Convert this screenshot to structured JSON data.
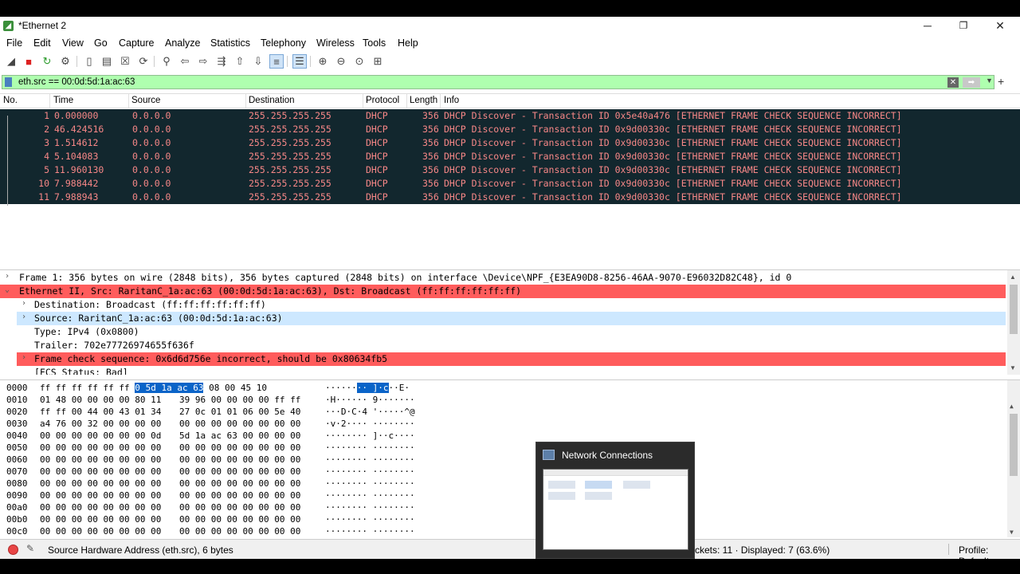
{
  "window": {
    "title": "*Ethernet 2",
    "app_icon_glyph": "◢"
  },
  "window_controls": {
    "minimize": "─",
    "restore": "❐",
    "close": "✕"
  },
  "menu": [
    "File",
    "Edit",
    "View",
    "Go",
    "Capture",
    "Analyze",
    "Statistics",
    "Telephony",
    "Wireless",
    "Tools",
    "Help"
  ],
  "toolbar": {
    "icons": [
      "shark-start-icon",
      "stop-capture-icon",
      "restart-capture-icon",
      "capture-options-icon",
      "open-file-icon",
      "save-file-icon",
      "close-file-icon",
      "reload-file-icon",
      "find-packet-icon",
      "go-back-icon",
      "go-forward-icon",
      "go-to-packet-icon",
      "go-first-icon",
      "go-last-icon",
      "auto-scroll-icon",
      "colorize-icon",
      "zoom-in-icon",
      "zoom-out-icon",
      "normal-size-icon",
      "resize-columns-icon"
    ],
    "glyphs": [
      "◢",
      "■",
      "↻",
      "⚙",
      "▯",
      "▤",
      "☒",
      "⟳",
      "⚲",
      "⇦",
      "⇨",
      "⇶",
      "⇧",
      "⇩",
      "≡",
      "☰",
      "⊕",
      "⊖",
      "⊙",
      "⊞"
    ]
  },
  "filter": {
    "value": "eth.src == 00:0d:5d:1a:ac:63",
    "clear_glyph": "✕",
    "apply_glyph": "➡",
    "dropdown_glyph": "▼",
    "add_glyph": "+"
  },
  "packet_list": {
    "columns": [
      "No.",
      "Time",
      "Source",
      "Destination",
      "Protocol",
      "Length",
      "Info"
    ],
    "rows": [
      {
        "no": "1",
        "time": "0.000000",
        "source": "0.0.0.0",
        "destination": "255.255.255.255",
        "protocol": "DHCP",
        "length": "356",
        "info": "DHCP Discover - Transaction ID 0x5e40a476 [ETHERNET FRAME CHECK SEQUENCE INCORRECT]"
      },
      {
        "no": "2",
        "time": "46.424516",
        "source": "0.0.0.0",
        "destination": "255.255.255.255",
        "protocol": "DHCP",
        "length": "356",
        "info": "DHCP Discover - Transaction ID 0x9d00330c [ETHERNET FRAME CHECK SEQUENCE INCORRECT]"
      },
      {
        "no": "3",
        "time": "1.514612",
        "source": "0.0.0.0",
        "destination": "255.255.255.255",
        "protocol": "DHCP",
        "length": "356",
        "info": "DHCP Discover - Transaction ID 0x9d00330c [ETHERNET FRAME CHECK SEQUENCE INCORRECT]"
      },
      {
        "no": "4",
        "time": "5.104083",
        "source": "0.0.0.0",
        "destination": "255.255.255.255",
        "protocol": "DHCP",
        "length": "356",
        "info": "DHCP Discover - Transaction ID 0x9d00330c [ETHERNET FRAME CHECK SEQUENCE INCORRECT]"
      },
      {
        "no": "5",
        "time": "11.960130",
        "source": "0.0.0.0",
        "destination": "255.255.255.255",
        "protocol": "DHCP",
        "length": "356",
        "info": "DHCP Discover - Transaction ID 0x9d00330c [ETHERNET FRAME CHECK SEQUENCE INCORRECT]"
      },
      {
        "no": "10",
        "time": "7.988442",
        "source": "0.0.0.0",
        "destination": "255.255.255.255",
        "protocol": "DHCP",
        "length": "356",
        "info": "DHCP Discover - Transaction ID 0x9d00330c [ETHERNET FRAME CHECK SEQUENCE INCORRECT]"
      },
      {
        "no": "11",
        "time": "7.988943",
        "source": "0.0.0.0",
        "destination": "255.255.255.255",
        "protocol": "DHCP",
        "length": "356",
        "info": "DHCP Discover - Transaction ID 0x9d00330c [ETHERNET FRAME CHECK SEQUENCE INCORRECT]"
      }
    ]
  },
  "details": {
    "rows": [
      {
        "text": "Frame 1: 356 bytes on wire (2848 bits), 356 bytes captured (2848 bits) on interface \\Device\\NPF_{E3EA90D8-8256-46AA-9070-E96032D82C48}, id 0",
        "arrow": "›",
        "style": "normal",
        "indent": 0
      },
      {
        "text": "Ethernet II, Src: RaritanC_1a:ac:63 (00:0d:5d:1a:ac:63), Dst: Broadcast (ff:ff:ff:ff:ff:ff)",
        "arrow": "⌄",
        "style": "red",
        "indent": 0
      },
      {
        "text": "Destination: Broadcast (ff:ff:ff:ff:ff:ff)",
        "arrow": "›",
        "style": "normal",
        "indent": 1
      },
      {
        "text": "Source: RaritanC_1a:ac:63 (00:0d:5d:1a:ac:63)",
        "arrow": "›",
        "style": "sel",
        "indent": 1
      },
      {
        "text": "Type: IPv4 (0x0800)",
        "arrow": "",
        "style": "normal",
        "indent": 1
      },
      {
        "text": "Trailer: 702e77726974655f636f",
        "arrow": "",
        "style": "normal",
        "indent": 1
      },
      {
        "text": "Frame check sequence: 0x6d6d756e incorrect, should be 0x80634fb5",
        "arrow": "›",
        "style": "red",
        "indent": 1
      },
      {
        "text": "[FCS Status: Bad]",
        "arrow": "",
        "style": "normal",
        "indent": 1
      }
    ]
  },
  "bytes": {
    "rows": [
      {
        "offset": "0000",
        "a": "ff ff ff ff ff ff ",
        "a_hl": "00 0d",
        "b_hl": "5d 1a ac 63",
        "b": " 08 00 45 10",
        "asc1": "······",
        "asc_hl": "·· ]",
        "asc_hl2": "·c",
        "asc2": "··E·"
      },
      {
        "offset": "0010",
        "a": "01 48 00 00 00 00 80 11",
        "b": "39 96 00 00 00 00 ff ff",
        "asc1": "·H······",
        "asc2": " 9·······"
      },
      {
        "offset": "0020",
        "a": "ff ff 00 44 00 43 01 34",
        "b": "27 0c 01 01 06 00 5e 40",
        "asc1": "···D·C·4",
        "asc2": " '·····^@"
      },
      {
        "offset": "0030",
        "a": "a4 76 00 32 00 00 00 00",
        "b": "00 00 00 00 00 00 00 00",
        "asc1": "·v·2····",
        "asc2": " ········"
      },
      {
        "offset": "0040",
        "a": "00 00 00 00 00 00 00 0d",
        "b": "5d 1a ac 63 00 00 00 00",
        "asc1": "········",
        "asc2": " ]··c····"
      },
      {
        "offset": "0050",
        "a": "00 00 00 00 00 00 00 00",
        "b": "00 00 00 00 00 00 00 00",
        "asc1": "········",
        "asc2": " ········"
      },
      {
        "offset": "0060",
        "a": "00 00 00 00 00 00 00 00",
        "b": "00 00 00 00 00 00 00 00",
        "asc1": "········",
        "asc2": " ········"
      },
      {
        "offset": "0070",
        "a": "00 00 00 00 00 00 00 00",
        "b": "00 00 00 00 00 00 00 00",
        "asc1": "········",
        "asc2": " ········"
      },
      {
        "offset": "0080",
        "a": "00 00 00 00 00 00 00 00",
        "b": "00 00 00 00 00 00 00 00",
        "asc1": "········",
        "asc2": " ········"
      },
      {
        "offset": "0090",
        "a": "00 00 00 00 00 00 00 00",
        "b": "00 00 00 00 00 00 00 00",
        "asc1": "········",
        "asc2": " ········"
      },
      {
        "offset": "00a0",
        "a": "00 00 00 00 00 00 00 00",
        "b": "00 00 00 00 00 00 00 00",
        "asc1": "········",
        "asc2": " ········"
      },
      {
        "offset": "00b0",
        "a": "00 00 00 00 00 00 00 00",
        "b": "00 00 00 00 00 00 00 00",
        "asc1": "········",
        "asc2": " ········"
      },
      {
        "offset": "00c0",
        "a": "00 00 00 00 00 00 00 00",
        "b": "00 00 00 00 00 00 00 00",
        "asc1": "········",
        "asc2": " ········"
      }
    ]
  },
  "status_bar": {
    "field_info": "Source Hardware Address (eth.src), 6 bytes",
    "packets": "ckets: 11 · Displayed: 7 (63.6%)",
    "profile": "Profile: Default",
    "edit_glyph": "✎"
  },
  "popup": {
    "title": "Network Connections"
  },
  "scroll_glyphs": {
    "up": "▲",
    "down": "▼"
  },
  "colors": {
    "row_bg": "#12272e",
    "row_fg": "#f78787",
    "filter_ok": "#afffaf",
    "error_red": "#ff5c5c",
    "selection": "#0a64c8"
  }
}
